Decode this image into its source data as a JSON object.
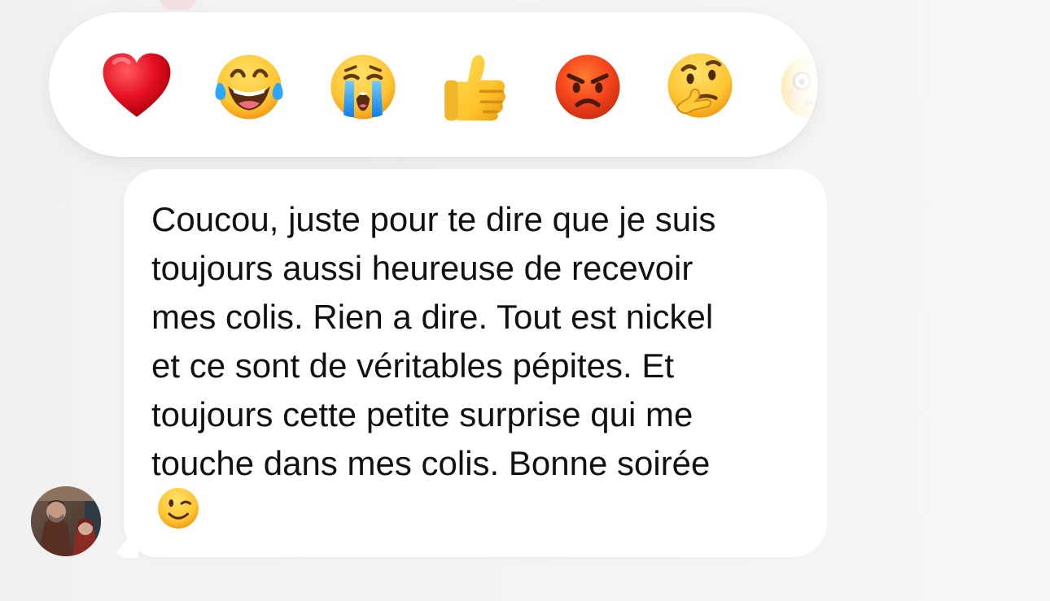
{
  "reactions": [
    {
      "icon": "red-heart-icon",
      "emoji": "❤️"
    },
    {
      "icon": "face-with-tears-of-joy-icon",
      "emoji": "😂"
    },
    {
      "icon": "loudly-crying-face-icon",
      "emoji": "😭"
    },
    {
      "icon": "thumbs-up-icon",
      "emoji": "👍"
    },
    {
      "icon": "angry-face-icon",
      "emoji": "😡"
    },
    {
      "icon": "thinking-face-icon",
      "emoji": "🤔"
    },
    {
      "icon": "flushed-face-icon",
      "emoji": "😳"
    }
  ],
  "message": {
    "text": "Coucou, juste pour te dire que je suis\ntoujours aussi heureuse de recevoir\nmes colis. Rien a dire. Tout est nickel\net ce sont de véritables pépites. Et\ntoujours cette petite surprise qui me\ntouche dans mes colis. Bonne soirée",
    "emoji": "😉"
  },
  "colors": {
    "background": "#f3f3f3",
    "bubble": "#ffffff",
    "text": "#111111"
  }
}
